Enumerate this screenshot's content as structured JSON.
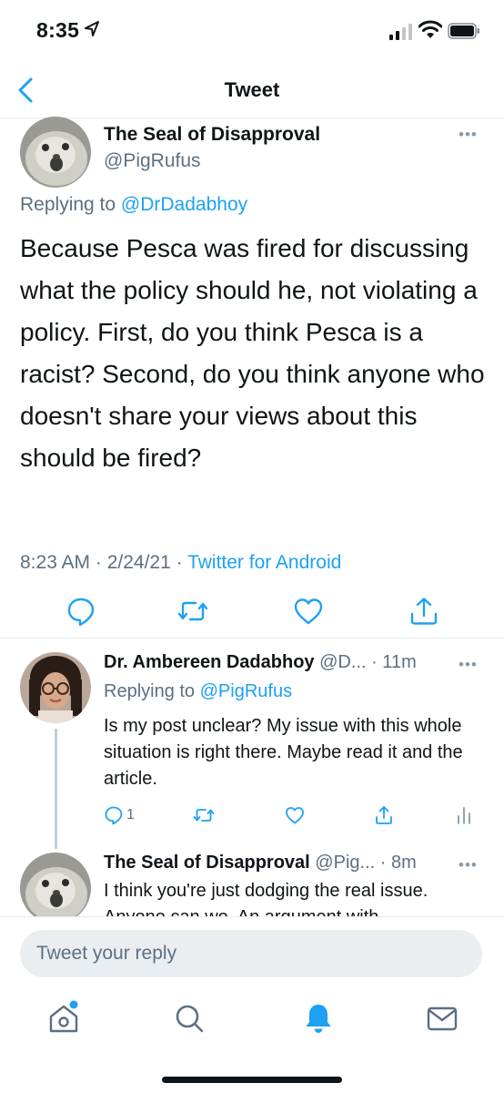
{
  "status_bar": {
    "time": "8:35"
  },
  "nav": {
    "title": "Tweet"
  },
  "main_tweet": {
    "author_name": "The Seal of Disapproval",
    "author_handle": "@PigRufus",
    "replying_prefix": "Replying to",
    "replying_to": "@DrDadabhoy",
    "text": "Because Pesca was fired for discussing what the policy should he, not violating a policy. First, do you think Pesca is a racist? Second, do you think anyone who doesn't share your views about this should be fired?",
    "timestamp": "8:23 AM · 2/24/21 · ",
    "source": "Twitter for Android"
  },
  "replies": [
    {
      "author_name": "Dr. Ambereen Dadabhoy",
      "author_handle": "@D...",
      "time": "· 11m",
      "replying_prefix": "Replying to",
      "replying_to": "@PigRufus",
      "text": "Is my post unclear? My issue with this whole situation is right there. Maybe read it and the article.",
      "reply_count": "1"
    },
    {
      "author_name": "The Seal of Disapproval",
      "author_handle": "@Pig...",
      "time": "· 8m",
      "text": "I think you're just dodging the real issue. Anyone can wo. An argument with"
    }
  ],
  "compose": {
    "placeholder": "Tweet your reply"
  },
  "colors": {
    "accent": "#1da1f2",
    "secondary_text": "#5b7083",
    "divider": "#e6ecf0",
    "input_bg": "#ebeef0"
  },
  "icons": [
    "location-arrow-icon",
    "signal-icon",
    "wifi-icon",
    "battery-icon",
    "back-chevron-icon",
    "reply-icon",
    "retweet-icon",
    "like-icon",
    "share-icon",
    "analytics-icon",
    "home-icon",
    "search-icon",
    "notifications-bell-icon",
    "messages-icon"
  ]
}
